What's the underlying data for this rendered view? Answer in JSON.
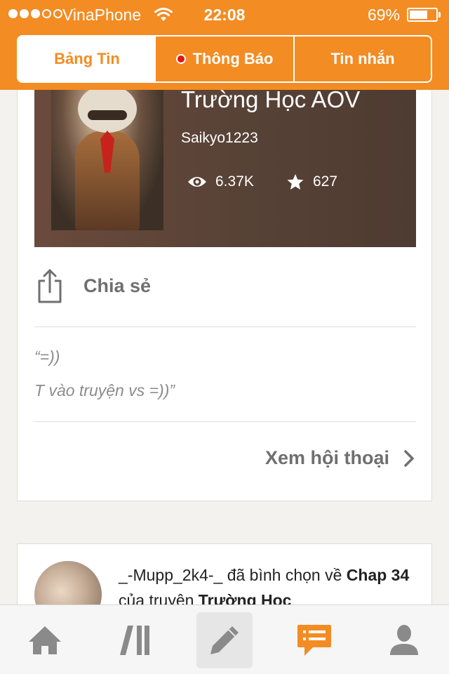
{
  "status_bar": {
    "carrier": "VinaPhone",
    "time": "22:08",
    "battery_percent": "69%",
    "battery_level": 0.69,
    "signal_bars_filled": 3,
    "signal_bars_total": 5
  },
  "segmented": {
    "tabs": [
      {
        "label": "Bảng Tin",
        "selected": true
      },
      {
        "label": "Thông Báo",
        "selected": false,
        "has_notification_dot": true
      },
      {
        "label": "Tin nhắn",
        "selected": false
      }
    ]
  },
  "story": {
    "title": "Trường Học AOV",
    "author": "Saikyo1223",
    "views": "6.37K",
    "votes": "627"
  },
  "share": {
    "label": "Chia sẻ"
  },
  "comment": {
    "line1": "“=))",
    "line2": "T vào truyện vs =))”"
  },
  "view_conversation": {
    "label": "Xem hội thoại"
  },
  "activity": {
    "user": "_-Mupp_2k4-_",
    "action": " đã bình chọn về ",
    "chapter": "Chap 34",
    "of_story": " của truyện ",
    "story": "Trường Học"
  },
  "tabbar": {
    "items": [
      "home",
      "library",
      "write",
      "notifications",
      "profile"
    ],
    "active": "notifications"
  },
  "colors": {
    "brand_orange": "#f38c23",
    "notification_red": "#e8140e",
    "tab_inactive": "#8a8a8a"
  }
}
